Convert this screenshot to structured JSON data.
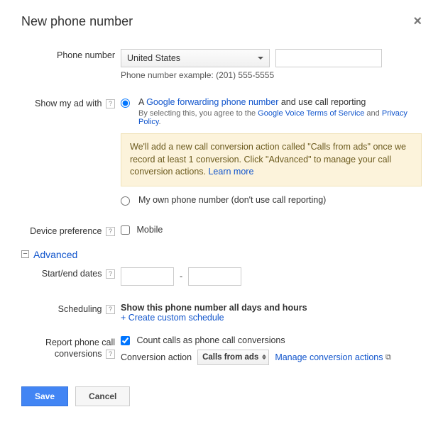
{
  "title": "New phone number",
  "phone_number": {
    "label": "Phone number",
    "country": "United States",
    "value": "",
    "example": "Phone number example: (201) 555-5555"
  },
  "show_ad": {
    "label": "Show my ad with",
    "opt1_prefix": "A ",
    "opt1_link": "Google forwarding phone number",
    "opt1_suffix": " and use call reporting",
    "agree_prefix": "By selecting this, you agree to the ",
    "agree_link1": "Google Voice Terms of Service",
    "agree_mid": " and ",
    "agree_link2": "Privacy Policy",
    "agree_suffix": ".",
    "info_text": "We'll add a new call conversion action called \"Calls from ads\" once we record at least 1 conversion. Click \"Advanced\" to manage your call conversion actions. ",
    "info_learn": "Learn more",
    "opt2": "My own phone number (don't use call reporting)"
  },
  "device_pref": {
    "label": "Device preference",
    "option": "Mobile"
  },
  "advanced": {
    "toggle": "Advanced",
    "dates_label": "Start/end dates",
    "sched_label": "Scheduling",
    "sched_title": "Show this phone number all days and hours",
    "sched_create": "+ Create custom schedule",
    "report_label": "Report phone call conversions",
    "report_check": "Count calls as phone call conversions",
    "conv_action_label": "Conversion action",
    "conv_action_value": "Calls from ads",
    "manage_link": "Manage conversion actions"
  },
  "buttons": {
    "save": "Save",
    "cancel": "Cancel"
  }
}
